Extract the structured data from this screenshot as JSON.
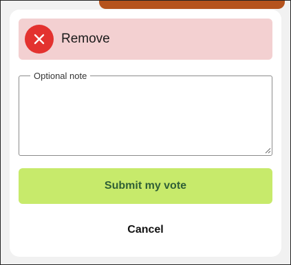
{
  "remove": {
    "label": "Remove",
    "icon": "close-icon",
    "icon_color": "#e3322f",
    "background": "#f3d0d1"
  },
  "note": {
    "legend": "Optional note",
    "value": ""
  },
  "actions": {
    "submit_label": "Submit my vote",
    "submit_color": "#c7ea6b",
    "cancel_label": "Cancel"
  },
  "top_strip_color": "#b5531d"
}
